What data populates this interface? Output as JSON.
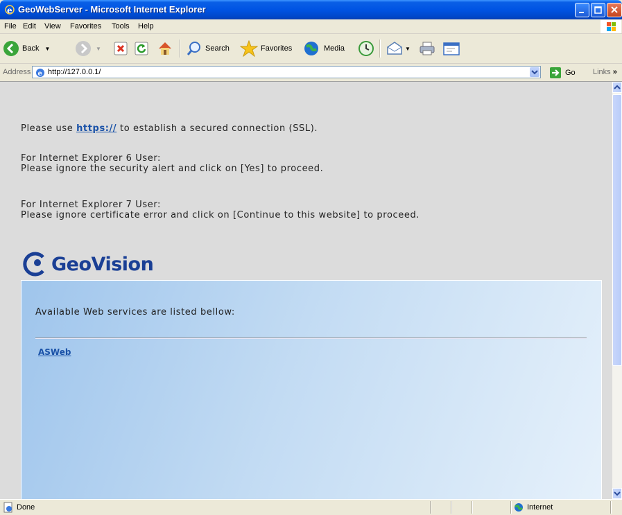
{
  "window": {
    "title": "GeoWebServer - Microsoft Internet Explorer"
  },
  "menu": [
    "File",
    "Edit",
    "View",
    "Favorites",
    "Tools",
    "Help"
  ],
  "toolbar": {
    "back": "Back",
    "search": "Search",
    "favorites": "Favorites",
    "media": "Media"
  },
  "address": {
    "label": "Address",
    "url": "http://127.0.0.1/",
    "go": "Go",
    "links": "Links"
  },
  "content": {
    "ssl_prefix": "Please use ",
    "ssl_link": "https://",
    "ssl_suffix": " to establish a secured connection (SSL).",
    "ie6_heading": "For Internet Explorer 6 User:",
    "ie6_text": "Please ignore the security alert and click on [Yes] to proceed.",
    "ie7_heading": "For Internet Explorer 7 User:",
    "ie7_text": "Please ignore certificate error and click on [Continue to this website] to proceed.",
    "logo": "GeoVision",
    "services_label": "Available Web services are listed bellow:",
    "services": [
      "ASWeb"
    ]
  },
  "status": {
    "text": "Done",
    "zone": "Internet"
  },
  "colors": {
    "titlebar": "#0054e3",
    "link": "#1a52a8",
    "page_bg": "#dcdcdc",
    "panel": "#c2dbf3"
  }
}
